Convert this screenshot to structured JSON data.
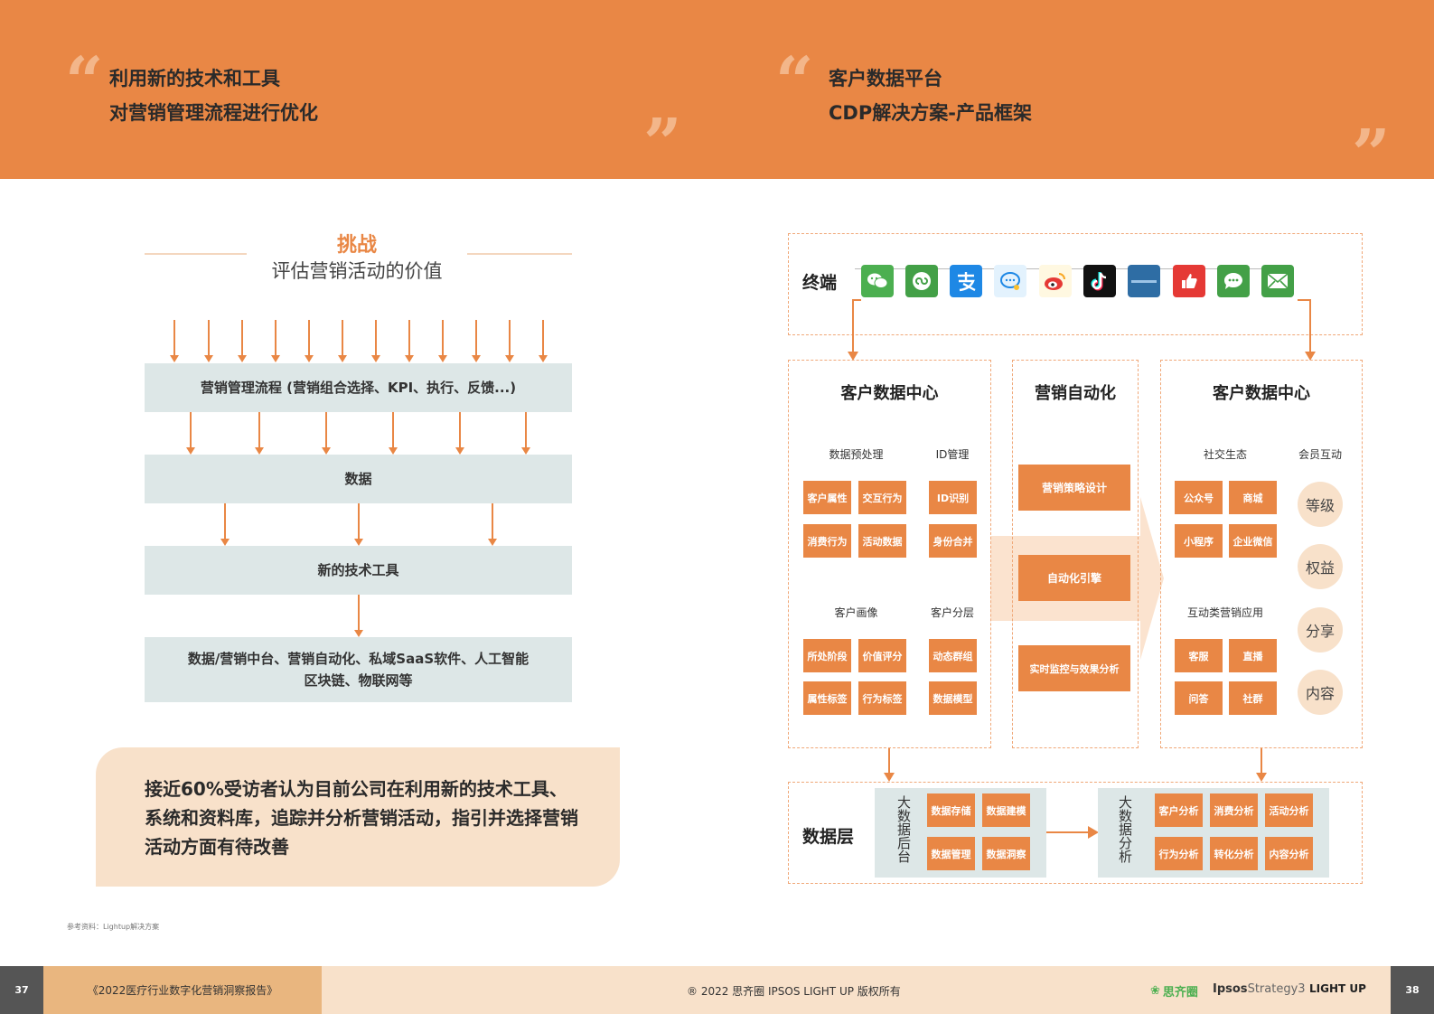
{
  "header": {
    "left_title_1": "利用新的技术和工具",
    "left_title_2": "对营销管理流程进行优化",
    "right_title_1": "客户数据平台",
    "right_title_2": "CDP解决方案-产品框架",
    "open_quote": "“",
    "close_quote": "”"
  },
  "left": {
    "challenge": "挑战",
    "subtitle": "评估营销活动的价值",
    "box1": "营销管理流程 (营销组合选择、KPI、执行、反馈...)",
    "box2": "数据",
    "box3": "新的技术工具",
    "box4_line1": "数据/营销中台、营销自动化、私域SaaS软件、人工智能",
    "box4_line2": "区块链、物联网等",
    "callout": "接近60%受访者认为目前公司在利用新的技术工具、系统和资料库，追踪并分析营销活动，指引并选择营销活动方面有待改善",
    "reference": "参考资料：Lightup解决方案"
  },
  "diagram": {
    "terminal_label": "终端",
    "terminal_icons": [
      "wechat-icon",
      "mini-program-icon",
      "alipay-icon",
      "chat-bubble-icon",
      "weibo-icon",
      "tiktok-icon",
      "web-banner-icon",
      "thumbs-up-icon",
      "message-icon",
      "mail-icon"
    ],
    "panel_left": {
      "title": "客户数据中心",
      "group1": "数据预处理",
      "group2": "ID管理",
      "group3": "客户画像",
      "group4": "客户分层",
      "g1_items": [
        "客户属性",
        "交互行为",
        "消费行为",
        "活动数据"
      ],
      "g2_items": [
        "ID识别",
        "身份合并"
      ],
      "g3_items": [
        "所处阶段",
        "价值评分",
        "属性标签",
        "行为标签"
      ],
      "g4_items": [
        "动态群组",
        "数据模型"
      ]
    },
    "panel_mid": {
      "title": "营销自动化",
      "items": [
        "营销策略设计",
        "自动化引擎",
        "实时监控与效果分析"
      ]
    },
    "panel_right": {
      "title": "客户数据中心",
      "group1": "社交生态",
      "group2": "会员互动",
      "group3": "互动类营销应用",
      "g1_items": [
        "公众号",
        "商城",
        "小程序",
        "企业微信"
      ],
      "circles": [
        "等级",
        "权益",
        "分享",
        "内容"
      ],
      "g3_items": [
        "客服",
        "直播",
        "问答",
        "社群"
      ]
    },
    "data_layer": {
      "label": "数据层",
      "backend_label": "大数据后台",
      "backend_items": [
        "数据存储",
        "数据建模",
        "数据管理",
        "数据洞察"
      ],
      "analysis_label": "大数据分析",
      "analysis_items": [
        "客户分析",
        "消费分析",
        "活动分析",
        "行为分析",
        "转化分析",
        "内容分析"
      ]
    }
  },
  "footer": {
    "page_left": "37",
    "book": "《2022医疗行业数字化营销洞察报告》",
    "copyright": "® 2022 思齐圈 IPSOS LIGHT UP 版权所有",
    "logo1": "思齐圈",
    "logo2_bold": "Ipsos",
    "logo2_light": "Strategy3",
    "logo3": "LIGHT UP",
    "page_right": "38"
  },
  "colors": {
    "orange": "#E98745",
    "peach": "#F8E1CA",
    "gray_box": "#DDE7E7"
  }
}
